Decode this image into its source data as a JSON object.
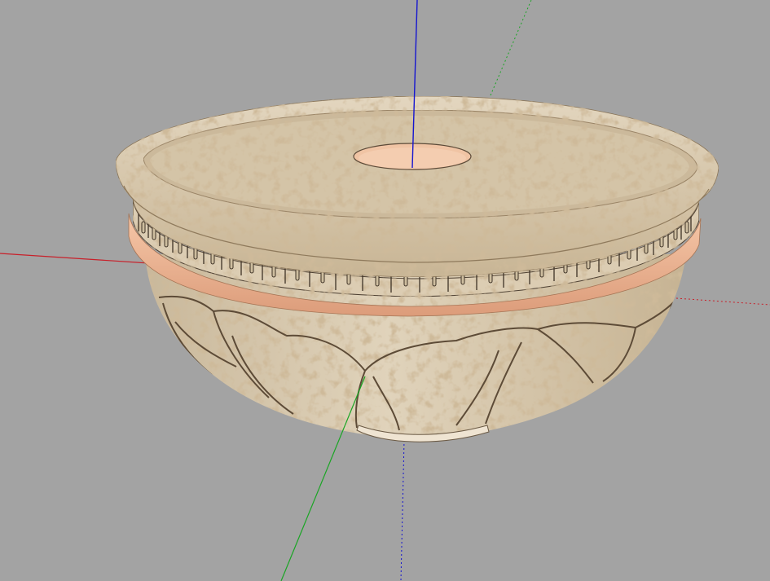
{
  "viewport": {
    "background": "#a3a3a3",
    "axes": {
      "x_color": "#c8202a",
      "y_color": "#1aa524",
      "z_color": "#1515d0"
    },
    "model": {
      "icon": "marble-bowl-model",
      "marble_base": "#dccdb3",
      "marble_dark": "#9c7c52",
      "band_color": "#f1b796",
      "hole_color": "#f0c4a4"
    }
  }
}
